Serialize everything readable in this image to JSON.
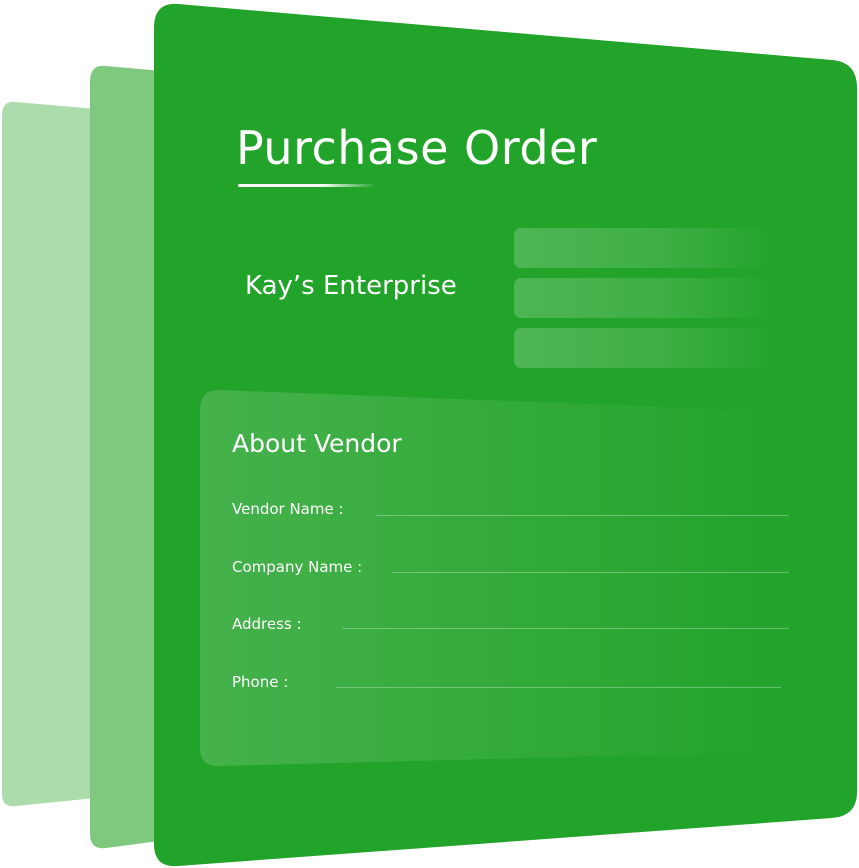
{
  "document": {
    "title": "Purchase Order",
    "company_name": "Kay’s Enterprise",
    "header_fields": [
      "",
      "",
      ""
    ]
  },
  "vendor_section": {
    "heading": "About Vendor",
    "fields": [
      {
        "label": "Vendor Name :",
        "value": ""
      },
      {
        "label": "Company Name :",
        "value": ""
      },
      {
        "label": "Address :",
        "value": ""
      },
      {
        "label": "Phone :",
        "value": ""
      }
    ]
  },
  "colors": {
    "brand_green": "#22a32a",
    "back_sheet_light": "#acdcab",
    "back_sheet_mid": "#7ec97d"
  }
}
